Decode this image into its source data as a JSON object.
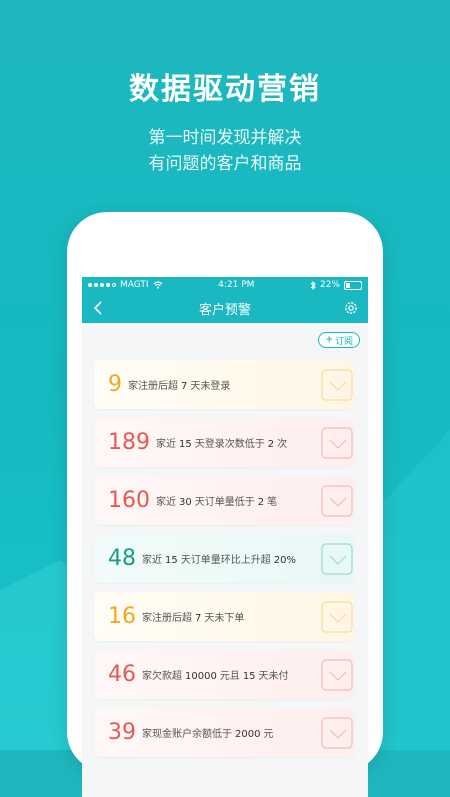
{
  "headline": "数据驱动营销",
  "subline1": "第一时间发现并解决",
  "subline2": "有问题的客户和商品",
  "status_bar": {
    "carrier": "MAGTI",
    "time": "4:21 PM",
    "battery": "22%"
  },
  "nav": {
    "title": "客户预警",
    "subscribe_label": "订阅"
  },
  "colors": {
    "accent": "#1ab9c1",
    "yellow": "#f2a81e",
    "red": "#e45a55",
    "green": "#1c9b84"
  },
  "alerts": [
    {
      "number": "9",
      "parts": [
        "家注册后超",
        "7",
        "天未登录"
      ],
      "color": "yellow"
    },
    {
      "number": "189",
      "parts": [
        "家近",
        "15",
        "天登录次数低于",
        "2",
        "次"
      ],
      "color": "red"
    },
    {
      "number": "160",
      "parts": [
        "家近",
        "30",
        "天订单量低于",
        "2",
        "笔"
      ],
      "color": "red"
    },
    {
      "number": "48",
      "parts": [
        "家近",
        "15",
        "天订单量环比上升超",
        "20%"
      ],
      "color": "green"
    },
    {
      "number": "16",
      "parts": [
        "家注册后超",
        "7",
        "天未下单"
      ],
      "color": "yellow"
    },
    {
      "number": "46",
      "parts": [
        "家欠款超",
        "10000",
        "元且",
        "15",
        "天未付"
      ],
      "color": "red"
    },
    {
      "number": "39",
      "parts": [
        "家现金账户余额低于",
        "2000",
        "元"
      ],
      "color": "red"
    }
  ]
}
